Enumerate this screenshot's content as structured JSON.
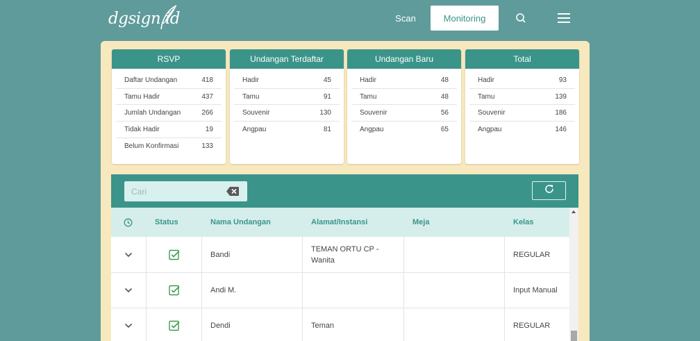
{
  "brand": {
    "logo_text": "dgsign.id"
  },
  "nav": {
    "scan": "Scan",
    "monitoring": "Monitoring"
  },
  "cards": [
    {
      "title": "RSVP",
      "rows": [
        {
          "label": "Daftar Undangan",
          "value": "418"
        },
        {
          "label": "Tamu Hadir",
          "value": "437"
        },
        {
          "label": "Jumlah Undangan",
          "value": "266"
        },
        {
          "label": "Tidak Hadir",
          "value": "19"
        },
        {
          "label": "Belum Konfirmasi",
          "value": "133"
        }
      ]
    },
    {
      "title": "Undangan Terdaftar",
      "rows": [
        {
          "label": "Hadir",
          "value": "45"
        },
        {
          "label": "Tamu",
          "value": "91"
        },
        {
          "label": "Souvenir",
          "value": "130"
        },
        {
          "label": "Angpau",
          "value": "81"
        }
      ]
    },
    {
      "title": "Undangan Baru",
      "rows": [
        {
          "label": "Hadir",
          "value": "48"
        },
        {
          "label": "Tamu",
          "value": "48"
        },
        {
          "label": "Souvenir",
          "value": "56"
        },
        {
          "label": "Angpau",
          "value": "65"
        }
      ]
    },
    {
      "title": "Total",
      "rows": [
        {
          "label": "Hadir",
          "value": "93"
        },
        {
          "label": "Tamu",
          "value": "139"
        },
        {
          "label": "Souvenir",
          "value": "186"
        },
        {
          "label": "Angpau",
          "value": "146"
        }
      ]
    }
  ],
  "search": {
    "placeholder": "Cari",
    "value": ""
  },
  "table": {
    "columns": [
      "Status",
      "Nama Undangan",
      "Alamat/Instansi",
      "Meja",
      "Kelas"
    ],
    "rows": [
      {
        "nama": "Bandi",
        "alamat": "TEMAN ORTU CP - Wanita",
        "meja": "",
        "kelas": "REGULAR"
      },
      {
        "nama": "Andi M.",
        "alamat": "",
        "meja": "",
        "kelas": "Input Manual"
      },
      {
        "nama": "Dendi",
        "alamat": "Teman",
        "meja": "",
        "kelas": "REGULAR"
      }
    ]
  },
  "colors": {
    "background": "#5f9b9b",
    "accent": "#3b9489",
    "panel": "#f7e8be",
    "header_row": "#d5eeeb",
    "check": "#3c9a4e"
  },
  "icons": {
    "search": "search-icon",
    "menu": "hamburger-menu-icon",
    "clear": "backspace-clear-icon",
    "refresh": "refresh-icon",
    "history": "clock-icon",
    "expand": "chevron-down-icon",
    "status": "checkbox-checked-icon",
    "logo": "feather-icon"
  }
}
